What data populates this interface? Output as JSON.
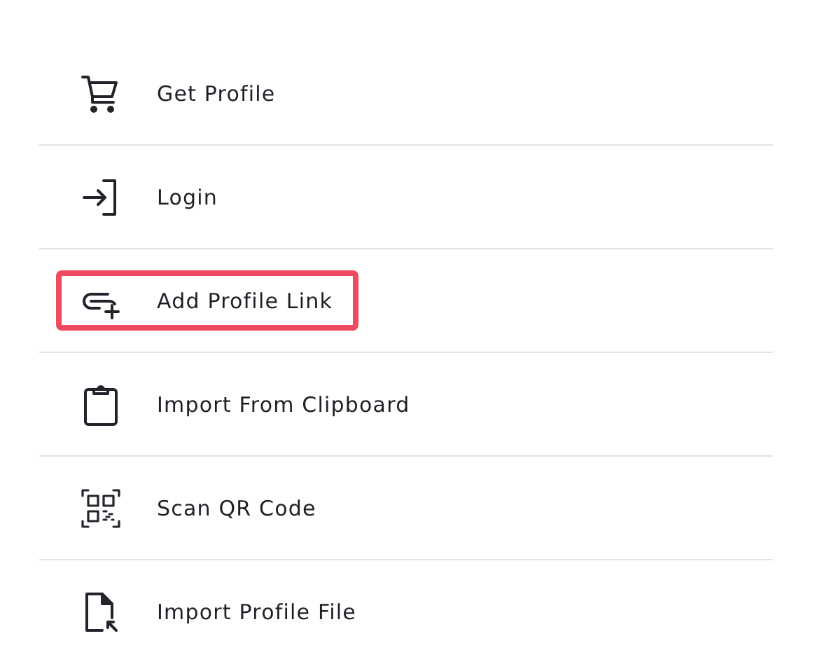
{
  "menu": {
    "items": [
      {
        "kind": "cart",
        "label": "Get Profile",
        "highlighted": false
      },
      {
        "kind": "login",
        "label": "Login",
        "highlighted": false
      },
      {
        "kind": "link",
        "label": "Add Profile Link",
        "highlighted": true
      },
      {
        "kind": "clipboard",
        "label": "Import From Clipboard",
        "highlighted": false
      },
      {
        "kind": "qr",
        "label": "Scan QR Code",
        "highlighted": false
      },
      {
        "kind": "file",
        "label": "Import Profile File",
        "highlighted": false
      }
    ]
  }
}
